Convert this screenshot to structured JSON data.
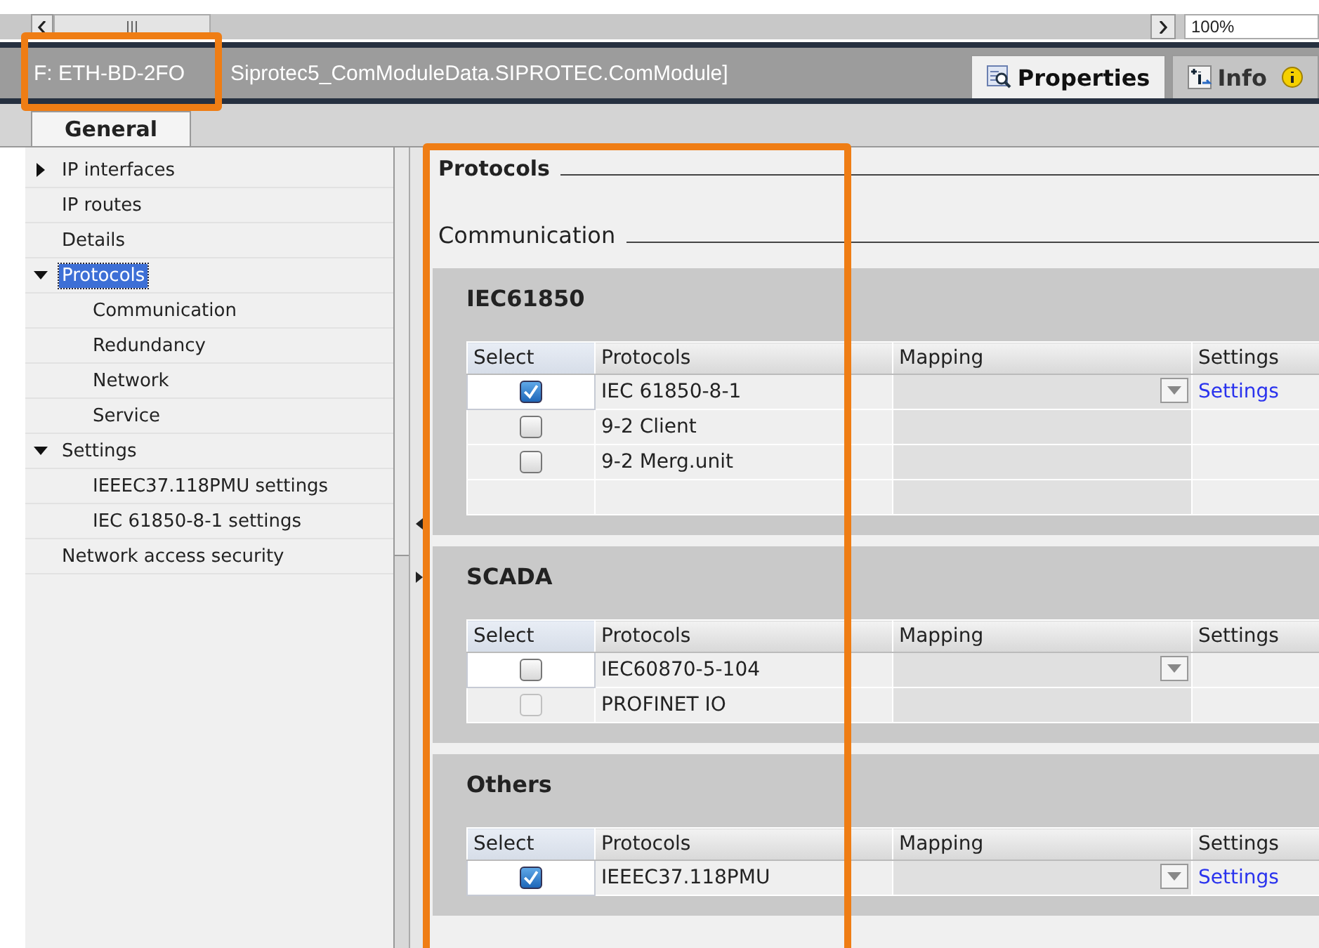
{
  "toolbar": {
    "zoom": "100%"
  },
  "title_bar": {
    "title": "F: ETH-BD-2FO",
    "subtitle": "Siprotec5_ComModuleData.SIPROTEC.ComModule]"
  },
  "inspector_tabs": [
    {
      "label": "Properties",
      "selected": true
    },
    {
      "label": "Info",
      "selected": false
    }
  ],
  "sub_tabs": [
    {
      "label": "General",
      "selected": true
    }
  ],
  "sidebar": {
    "items": [
      {
        "label": "IP interfaces",
        "expanded": false,
        "selected": false
      },
      {
        "label": "IP routes",
        "selected": false
      },
      {
        "label": "Details",
        "selected": false
      },
      {
        "label": "Protocols",
        "expanded": true,
        "selected": true,
        "children": [
          {
            "label": "Communication",
            "selected": false
          },
          {
            "label": "Redundancy",
            "selected": false
          },
          {
            "label": "Network",
            "selected": false
          },
          {
            "label": "Service",
            "selected": false
          }
        ]
      },
      {
        "label": "Settings",
        "expanded": true,
        "selected": false,
        "children": [
          {
            "label": "IEEEC37.118PMU settings",
            "selected": false
          },
          {
            "label": "IEC 61850-8-1 settings",
            "selected": false
          }
        ]
      },
      {
        "label": "Network access security",
        "selected": false
      }
    ]
  },
  "content": {
    "heading": "Protocols",
    "subheading": "Communication",
    "sections": [
      {
        "title": "IEC61850",
        "columns": [
          "Select",
          "Protocols",
          "Mapping",
          "Settings"
        ],
        "filler_row": true,
        "rows": [
          {
            "protocol": "IEC 61850-8-1",
            "checked": true,
            "disabled": false,
            "dropdown": true,
            "settings": "Settings",
            "focused": true
          },
          {
            "protocol": "9-2 Client",
            "checked": false,
            "disabled": false,
            "dropdown": false,
            "focused": false
          },
          {
            "protocol": "9-2 Merg.unit",
            "checked": false,
            "disabled": false,
            "dropdown": false,
            "focused": false
          }
        ]
      },
      {
        "title": "SCADA",
        "columns": [
          "Select",
          "Protocols",
          "Mapping",
          "Settings"
        ],
        "filler_row": false,
        "rows": [
          {
            "protocol": "IEC60870-5-104",
            "checked": false,
            "disabled": false,
            "dropdown": true,
            "focused": true
          },
          {
            "protocol": "PROFINET IO",
            "checked": false,
            "disabled": true,
            "dropdown": false,
            "focused": false
          }
        ]
      },
      {
        "title": "Others",
        "columns": [
          "Select",
          "Protocols",
          "Mapping",
          "Settings"
        ],
        "filler_row": false,
        "rows": [
          {
            "protocol": "IEEEC37.118PMU",
            "checked": true,
            "disabled": false,
            "dropdown": true,
            "settings": "Settings",
            "focused": true
          }
        ]
      }
    ]
  }
}
